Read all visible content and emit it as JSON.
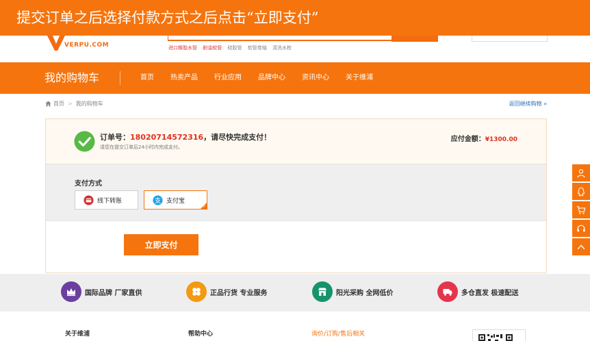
{
  "banner": {
    "text": "提交订单之后选择付款方式之后点击“立即支付”"
  },
  "header": {
    "logo_text": "VERPU.COM",
    "hotwords": [
      "进口橡胶水管",
      "耐油软管",
      "硅胶管",
      "软管卷轴",
      "清洗水枪"
    ]
  },
  "nav": {
    "title": "我的购物车",
    "items": [
      "首页",
      "热卖产品",
      "行业应用",
      "品牌中心",
      "资讯中心",
      "关于维浦"
    ]
  },
  "breadcrumb": {
    "home": "首页",
    "current": "我的购物车",
    "back_link": "返回继续购物 »"
  },
  "order": {
    "label_prefix": "订单号：",
    "number": "18020714572316",
    "label_suffix": "，请尽快完成支付！",
    "sub": "请您在提交订单后24小时内完成支付。",
    "amount_label": "应付金额：",
    "amount_value": "¥1300.00"
  },
  "payment": {
    "label": "支付方式",
    "options": [
      "线下转账",
      "支付宝"
    ],
    "selected": "支付宝",
    "submit": "立即支付"
  },
  "features": [
    {
      "text": "国际品牌 厂家直供",
      "color": "#6b3fa0"
    },
    {
      "text": "正品行货 专业服务",
      "color": "#f39a12"
    },
    {
      "text": "阳光采购 全网低价",
      "color": "#17936b"
    },
    {
      "text": "多仓直发 极速配送",
      "color": "#e5354d"
    }
  ],
  "footer": {
    "col1": "关于维浦",
    "col2": "帮助中心",
    "col3": "询价/订购/售后相关"
  },
  "colors": {
    "brand": "#f6740d",
    "price": "#e0301e"
  }
}
